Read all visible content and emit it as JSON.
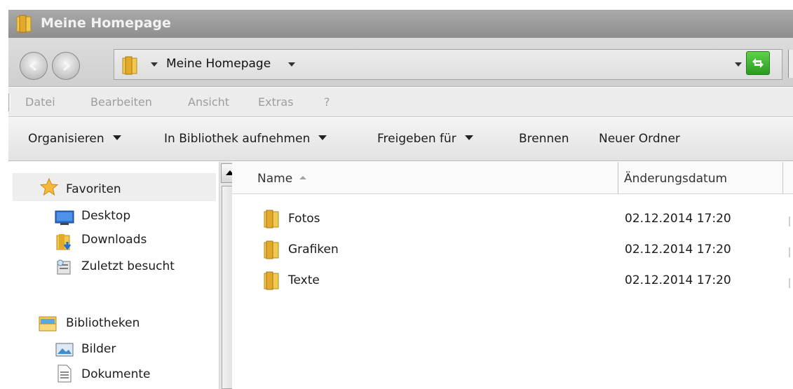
{
  "window": {
    "title": "Meine Homepage"
  },
  "address": {
    "path": "Meine Homepage"
  },
  "menu": [
    "Datei",
    "Bearbeiten",
    "Ansicht",
    "Extras",
    "?"
  ],
  "commands": {
    "organize": "Organisieren",
    "library": "In Bibliothek aufnehmen",
    "share": "Freigeben für",
    "burn": "Brennen",
    "new_folder": "Neuer Ordner"
  },
  "nav": {
    "favorites": {
      "label": "Favoriten",
      "icon": "star-icon"
    },
    "fav_items": [
      {
        "label": "Desktop",
        "icon": "desktop-icon"
      },
      {
        "label": "Downloads",
        "icon": "downloads-icon"
      },
      {
        "label": "Zuletzt besucht",
        "icon": "recent-places-icon"
      }
    ],
    "libraries": {
      "label": "Bibliotheken",
      "icon": "libraries-icon"
    },
    "lib_items": [
      {
        "label": "Bilder",
        "icon": "pictures-icon"
      },
      {
        "label": "Dokumente",
        "icon": "documents-icon"
      }
    ]
  },
  "columns": {
    "name": "Name",
    "date": "Änderungsdatum"
  },
  "files": [
    {
      "name": "Fotos",
      "date": "02.12.2014 17:20",
      "icon": "folder-icon"
    },
    {
      "name": "Grafiken",
      "date": "02.12.2014 17:20",
      "icon": "folder-icon"
    },
    {
      "name": "Texte",
      "date": "02.12.2014 17:20",
      "icon": "folder-icon"
    }
  ],
  "colors": {
    "folder": "#e8b93a",
    "title_bar": "#9c9c9c",
    "refresh": "#3cb52c"
  }
}
